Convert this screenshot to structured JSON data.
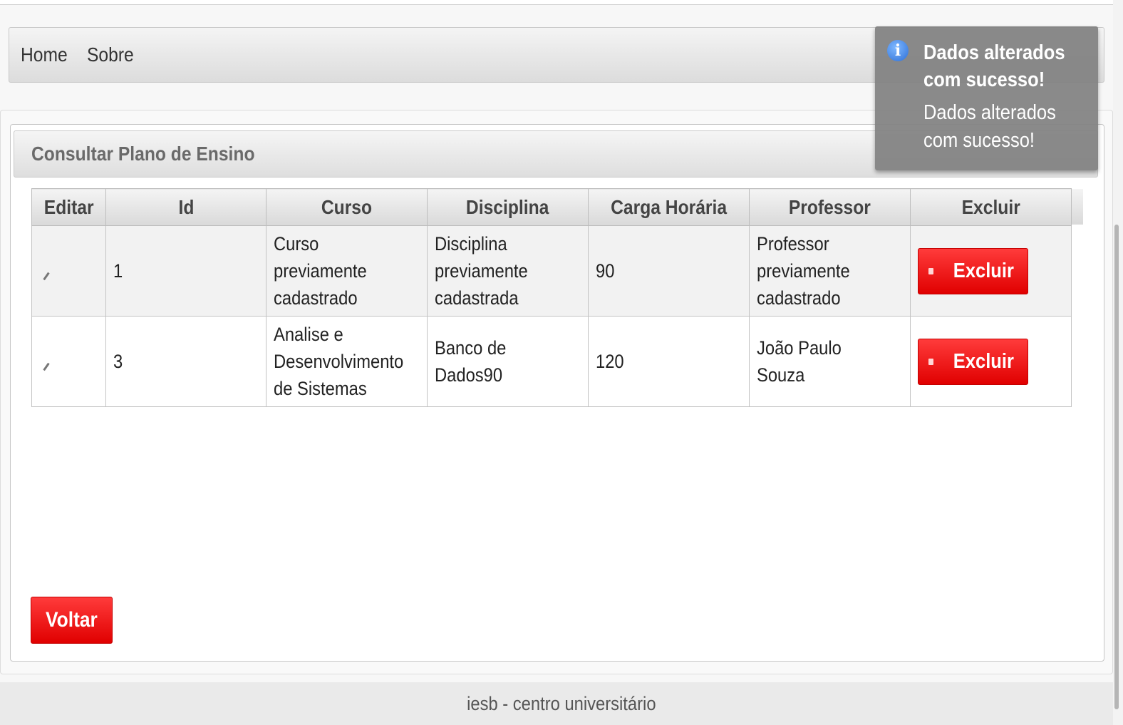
{
  "menu": {
    "items": [
      {
        "label": "Home"
      },
      {
        "label": "Sobre"
      }
    ]
  },
  "panel": {
    "title": "Consultar Plano de Ensino"
  },
  "table": {
    "headers": [
      "Editar",
      "Id",
      "Curso",
      "Disciplina",
      "Carga Horária",
      "Professor",
      "Excluir"
    ],
    "rows": [
      {
        "id": "1",
        "curso": "Curso previamente cadastrado",
        "disciplina": "Disciplina previamente cadastrada",
        "carga": "90",
        "professor": "Professor previamente cadastrado",
        "excluir_label": "Excluir"
      },
      {
        "id": "3",
        "curso": "Analise e Desenvolvimento de Sistemas",
        "disciplina": "Banco de Dados90",
        "carga": "120",
        "professor": "João Paulo Souza",
        "excluir_label": "Excluir"
      }
    ]
  },
  "actions": {
    "voltar_label": "Voltar"
  },
  "growl": {
    "icon": "info-icon",
    "summary": "Dados alterados com sucesso!",
    "detail": "Dados alterados com sucesso!"
  },
  "footer": {
    "text": "iesb - centro universitário"
  },
  "colors": {
    "danger": "#e00000",
    "growl_bg": "#808080"
  }
}
